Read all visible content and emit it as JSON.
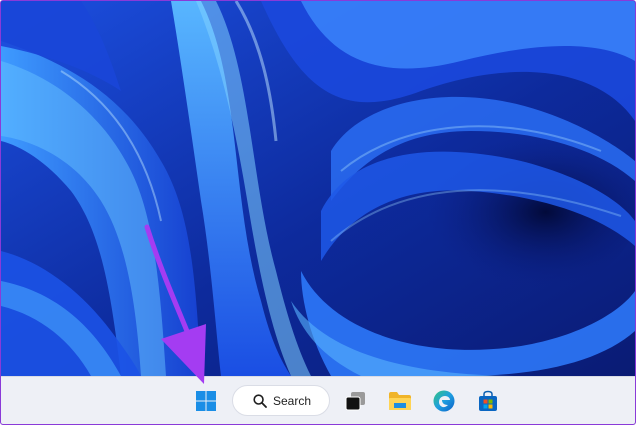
{
  "taskbar": {
    "start_icon": "windows-start-icon",
    "search": {
      "label": "Search",
      "icon": "magnifier-icon"
    },
    "apps": [
      {
        "icon": "task-view-icon"
      },
      {
        "icon": "file-explorer-icon"
      },
      {
        "icon": "edge-icon"
      },
      {
        "icon": "microsoft-store-icon"
      }
    ]
  },
  "annotation": {
    "icon": "arrow-icon",
    "color": "#a43cf2"
  },
  "colors": {
    "taskbar_bg": "#eef0f6",
    "wallpaper_deep": "#0a1b74",
    "wallpaper_bright": "#2f8dff",
    "border": "#8a3ad8"
  }
}
